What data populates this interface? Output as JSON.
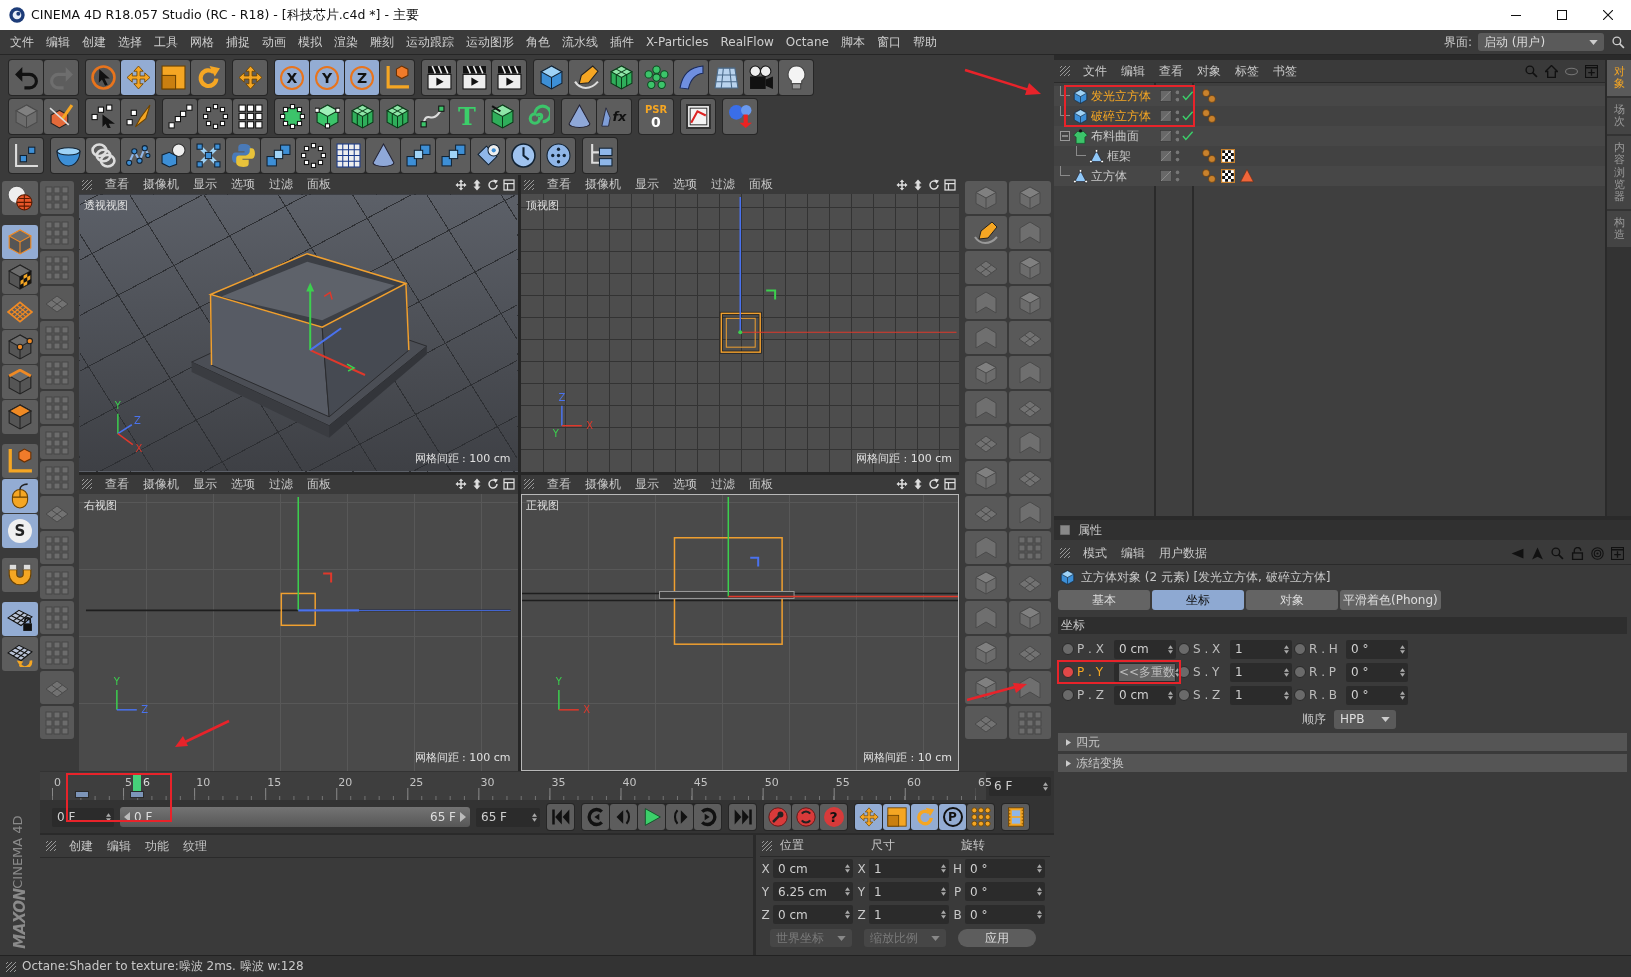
{
  "window": {
    "title": "CINEMA 4D R18.057 Studio (RC - R18) - [科技芯片.c4d *] - 主要"
  },
  "menu": [
    "文件",
    "编辑",
    "创建",
    "选择",
    "工具",
    "网格",
    "捕捉",
    "动画",
    "模拟",
    "渲染",
    "雕刻",
    "运动跟踪",
    "运动图形",
    "角色",
    "流水线",
    "插件",
    "X-Particles",
    "RealFlow",
    "Octane",
    "脚本",
    "窗口",
    "帮助"
  ],
  "layout_selector": {
    "label": "界面:",
    "value": "启动 (用户)"
  },
  "toolbar": [
    [
      [
        {
          "kind": "undo"
        },
        {
          "kind": "redo"
        }
      ],
      [
        {
          "kind": "select",
          "selected": false
        },
        {
          "kind": "move",
          "selected": true
        },
        {
          "kind": "scale",
          "selected": false
        },
        {
          "kind": "rotate",
          "selected": false
        }
      ],
      [
        {
          "kind": "move"
        }
      ],
      [
        {
          "kind": "letter",
          "label": "X",
          "selected": true
        },
        {
          "kind": "letter",
          "label": "Y",
          "selected": true
        },
        {
          "kind": "letter",
          "label": "Z",
          "selected": true
        },
        {
          "kind": "axes"
        }
      ],
      [
        {
          "kind": "clapper"
        },
        {
          "kind": "clapper"
        },
        {
          "kind": "clapper"
        }
      ],
      [
        {
          "kind": "cube"
        },
        {
          "kind": "pen"
        },
        {
          "kind": "cage-cube"
        },
        {
          "kind": "cloner"
        },
        {
          "kind": "bend"
        },
        {
          "kind": "floor"
        },
        {
          "kind": "camera"
        },
        {
          "kind": "bulb"
        }
      ]
    ],
    [
      [
        {
          "kind": "faded-cube"
        },
        {
          "kind": "cube-pen"
        }
      ],
      [
        {
          "kind": "live-select"
        },
        {
          "kind": "brush"
        }
      ],
      [
        {
          "kind": "points"
        },
        {
          "kind": "ring-dots"
        },
        {
          "kind": "grid-dots"
        }
      ],
      [
        {
          "kind": "dot-sphere"
        },
        {
          "kind": "dot-cube"
        },
        {
          "kind": "cage-cube"
        },
        {
          "kind": "cage-cube"
        },
        {
          "kind": "spline"
        },
        {
          "kind": "text",
          "label": "T"
        },
        {
          "kind": "extrude"
        },
        {
          "kind": "spiral"
        }
      ],
      [
        {
          "kind": "cone"
        },
        {
          "kind": "fx",
          "label": "fx"
        }
      ],
      [
        {
          "kind": "psr",
          "label": "PSR",
          "value": "0"
        }
      ],
      [
        {
          "kind": "frame"
        }
      ],
      [
        {
          "kind": "balls"
        }
      ]
    ],
    [
      [
        {
          "kind": "chart-axis"
        }
      ],
      [
        {
          "kind": "bowl"
        },
        {
          "kind": "spring"
        },
        {
          "kind": "zigzag"
        },
        {
          "kind": "cube-sphere"
        },
        {
          "kind": "cross"
        },
        {
          "kind": "python"
        },
        {
          "kind": "cubes"
        },
        {
          "kind": "ring-dots"
        },
        {
          "kind": "grid"
        },
        {
          "kind": "cone"
        },
        {
          "kind": "cubes"
        },
        {
          "kind": "cubes"
        },
        {
          "kind": "cylinder"
        },
        {
          "kind": "clock"
        },
        {
          "kind": "dot-disc"
        }
      ],
      [
        {
          "kind": "hierarchy"
        }
      ]
    ]
  ],
  "left_palette": [
    {
      "kind": "globe",
      "selected": false
    },
    {
      "kind": "model-cube",
      "selected": true
    },
    {
      "kind": "checker-cube",
      "selected": false
    },
    {
      "kind": "grid-plane",
      "selected": false
    },
    {
      "kind": "point-cube",
      "selected": false
    },
    {
      "kind": "edge-cube",
      "selected": false
    },
    {
      "kind": "poly-cube",
      "selected": false
    },
    {
      "kind": "axes",
      "selected": false
    },
    {
      "kind": "tweak",
      "selected": true
    },
    {
      "kind": "letter",
      "label": "S",
      "selected": true
    },
    {
      "kind": "magnet",
      "selected": false
    },
    {
      "kind": "mesh-lock",
      "selected": true
    },
    {
      "kind": "mesh-spin",
      "selected": false
    }
  ],
  "viewports": [
    {
      "kind": "perspective",
      "title": "透视视图",
      "menu": [
        "查看",
        "摄像机",
        "显示",
        "选项",
        "过滤",
        "面板"
      ],
      "grid_label": "网格间距 : 100 cm",
      "active": false,
      "axes": [
        {
          "kind": "y",
          "label": "Y"
        },
        {
          "kind": "z",
          "label": "Z"
        },
        {
          "kind": "x",
          "label": "X"
        }
      ]
    },
    {
      "kind": "top",
      "title": "顶视图",
      "menu": [
        "查看",
        "摄像机",
        "显示",
        "选项",
        "过滤",
        "面板"
      ],
      "grid_label": "网格间距 : 100 cm",
      "active": false,
      "axes": [
        {
          "kind": "z",
          "label": "Z"
        },
        {
          "kind": "y",
          "label": "Y"
        },
        {
          "kind": "x",
          "label": "X"
        }
      ]
    },
    {
      "kind": "right",
      "title": "右视图",
      "menu": [
        "查看",
        "摄像机",
        "显示",
        "选项",
        "过滤",
        "面板"
      ],
      "grid_label": "网格间距 : 100 cm",
      "active": false,
      "axes": [
        {
          "kind": "y",
          "label": "Y"
        },
        {
          "kind": "z",
          "label": "Z"
        }
      ]
    },
    {
      "kind": "front",
      "title": "正视图",
      "menu": [
        "查看",
        "摄像机",
        "显示",
        "选项",
        "过滤",
        "面板"
      ],
      "grid_label": "网格间距 : 10 cm",
      "active": true,
      "axes": [
        {
          "kind": "y",
          "label": "Y"
        },
        {
          "kind": "x",
          "label": "X"
        }
      ]
    }
  ],
  "timeline": {
    "ticks": [
      "0",
      "5",
      "10",
      "15",
      "20",
      "25",
      "30",
      "35",
      "40",
      "45",
      "50",
      "55",
      "60",
      "65"
    ],
    "current_frame": {
      "label": "6",
      "level": 0.092
    },
    "keyframes": [
      {
        "level": 0.033
      },
      {
        "level": 0.092
      }
    ],
    "frame_field": "6 F"
  },
  "transport": {
    "start_field": "0 F",
    "range": {
      "start": "0 F",
      "end": "65 F",
      "level": 1
    },
    "end_field": "65 F",
    "groups": [
      [
        {
          "kind": "go-start"
        }
      ],
      [
        {
          "kind": "prev-key"
        },
        {
          "kind": "prev-frame"
        },
        {
          "kind": "play"
        },
        {
          "kind": "next-frame"
        },
        {
          "kind": "next-key"
        }
      ],
      [
        {
          "kind": "go-end"
        }
      ],
      [
        {
          "kind": "record"
        },
        {
          "kind": "auto-key"
        },
        {
          "kind": "help-key",
          "label": "?"
        }
      ],
      [
        {
          "kind": "move",
          "selected": true
        },
        {
          "kind": "scale",
          "selected": true
        },
        {
          "kind": "rotate",
          "selected": true
        },
        {
          "kind": "param",
          "label": "P",
          "selected": true
        },
        {
          "kind": "dots",
          "selected": false
        }
      ],
      [
        {
          "kind": "film"
        }
      ]
    ]
  },
  "materials": {
    "menu": [
      "创建",
      "编辑",
      "功能",
      "纹理"
    ]
  },
  "coordinates": {
    "headers": [
      "位置",
      "尺寸",
      "旋转"
    ],
    "rows": [
      [
        {
          "label": "X",
          "value": "0 cm"
        },
        {
          "label": "X",
          "value": "1"
        },
        {
          "label": "H",
          "value": "0 °"
        }
      ],
      [
        {
          "label": "Y",
          "value": "6.25 cm"
        },
        {
          "label": "Y",
          "value": "1"
        },
        {
          "label": "P",
          "value": "0 °"
        }
      ],
      [
        {
          "label": "Z",
          "value": "0 cm"
        },
        {
          "label": "Z",
          "value": "1"
        },
        {
          "label": "B",
          "value": "0 °"
        }
      ]
    ],
    "dropdowns": [
      {
        "value": "世界坐标",
        "disabled": true
      },
      {
        "value": "缩放比例",
        "disabled": true
      }
    ],
    "apply": "应用"
  },
  "logo": {
    "brand": "MAXON",
    "product": "CINEMA 4D"
  },
  "object_manager": {
    "menu": [
      "文件",
      "编辑",
      "查看",
      "对象",
      "标签",
      "书签"
    ],
    "objects": [
      {
        "name": "发光立方体",
        "kind": "cube",
        "selected": true,
        "checked": true,
        "tags": [
          {
            "kind": "phong"
          }
        ]
      },
      {
        "name": "破碎立方体",
        "kind": "cube",
        "selected": true,
        "checked": true,
        "tags": [
          {
            "kind": "phong"
          }
        ]
      },
      {
        "name": "布料曲面",
        "kind": "cloth",
        "selected": false,
        "checked": true,
        "expanded": true,
        "children": [
          {
            "name": "框架",
            "kind": "polygon",
            "selected": false,
            "checked": false,
            "tags": [
              {
                "kind": "phong"
              },
              {
                "kind": "material"
              }
            ]
          }
        ]
      },
      {
        "name": "立方体",
        "kind": "polygon",
        "selected": false,
        "checked": false,
        "tags": [
          {
            "kind": "phong"
          },
          {
            "kind": "material"
          },
          {
            "kind": "warning"
          }
        ]
      }
    ],
    "side_tabs": [
      {
        "label": "对象",
        "selected": true
      },
      {
        "label": "场次",
        "selected": false
      },
      {
        "label": "内容浏览器",
        "selected": false
      },
      {
        "label": "构造",
        "selected": false
      }
    ]
  },
  "attributes": {
    "title": "属性",
    "menu": [
      "模式",
      "编辑",
      "用户数据"
    ],
    "object_title": "立方体对象 (2 元素) [发光立方体, 破碎立方体]",
    "tabs": [
      {
        "label": "基本",
        "selected": false
      },
      {
        "label": "坐标",
        "selected": true
      },
      {
        "label": "对象",
        "selected": false
      },
      {
        "label": "平滑着色(Phong)",
        "selected": false
      }
    ],
    "section": "坐标",
    "fields": [
      [
        {
          "label": "P . X",
          "value": "0 cm",
          "keyed": false,
          "mixed": false
        },
        {
          "label": "S . X",
          "value": "1",
          "keyed": false,
          "mixed": false
        },
        {
          "label": "R . H",
          "value": "0 °",
          "keyed": false,
          "mixed": false
        }
      ],
      [
        {
          "label": "P . Y",
          "value": "<<多重数",
          "keyed": true,
          "mixed": true
        },
        {
          "label": "S . Y",
          "value": "1",
          "keyed": false,
          "mixed": false
        },
        {
          "label": "R . P",
          "value": "0 °",
          "keyed": false,
          "mixed": false
        }
      ],
      [
        {
          "label": "P . Z",
          "value": "0 cm",
          "keyed": false,
          "mixed": false
        },
        {
          "label": "S . Z",
          "value": "1",
          "keyed": false,
          "mixed": false
        },
        {
          "label": "R . B",
          "value": "0 °",
          "keyed": false,
          "mixed": false
        }
      ]
    ],
    "order": {
      "label": "顺序",
      "value": "HPB"
    },
    "groups": [
      {
        "label": "四元",
        "expanded": false
      },
      {
        "label": "冻结变换",
        "expanded": false
      }
    ]
  },
  "status_bar": "Octane:Shader to texture:噪波 2ms. 噪波 w:128"
}
